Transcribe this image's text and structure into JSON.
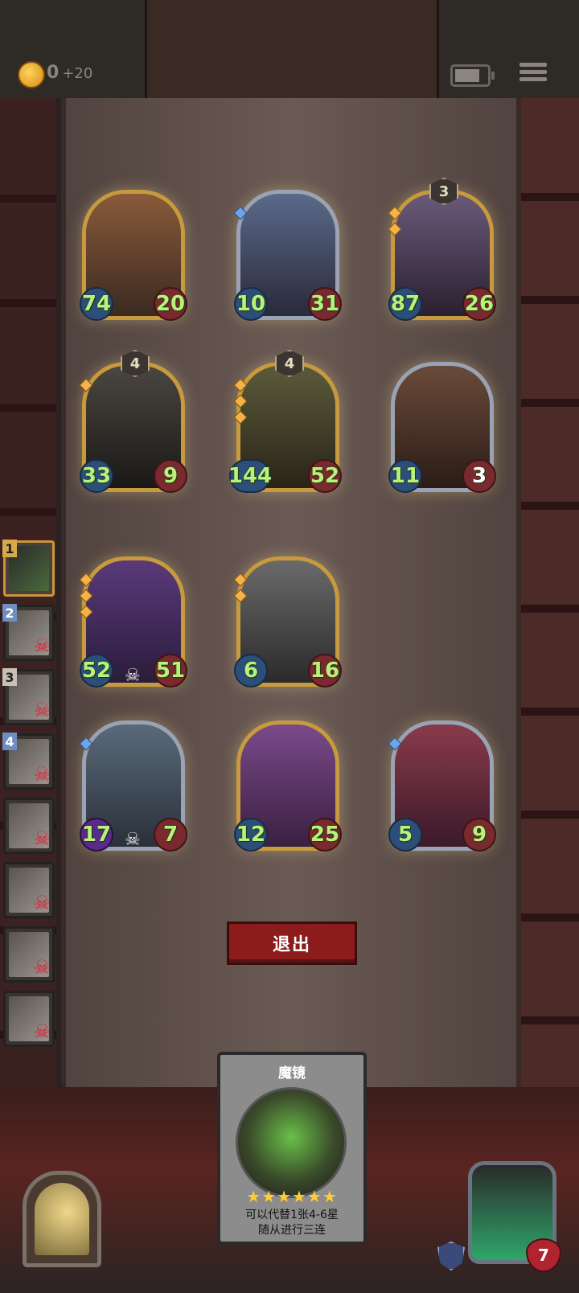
{
  "topbar": {
    "gold": "0",
    "gold_income": "+20"
  },
  "board": {
    "minions": [
      {
        "attack": "74",
        "health": "20",
        "tier": "",
        "frame": "gold",
        "art_color": "#8a5a3a"
      },
      {
        "attack": "10",
        "health": "31",
        "tier": "",
        "frame": "silver",
        "art_color": "#5a6a8a"
      },
      {
        "attack": "87",
        "health": "26",
        "tier": "3",
        "frame": "gold",
        "art_color": "#6a5a7a"
      },
      {
        "attack": "33",
        "health": "9",
        "tier": "4",
        "frame": "gold",
        "art_color": "#4a4640"
      },
      {
        "attack": "144",
        "health": "52",
        "tier": "4",
        "frame": "gold",
        "art_color": "#5a5a3a"
      },
      {
        "attack": "11",
        "health": "3",
        "tier": "",
        "frame": "silver",
        "art_color": "#6a4a3a"
      },
      {
        "attack": "52",
        "health": "51",
        "tier": "",
        "frame": "gold",
        "art_color": "#5a3a7a"
      },
      {
        "attack": "6",
        "health": "16",
        "tier": "",
        "frame": "gold",
        "art_color": "#6a6a6a"
      },
      {
        "attack": "17",
        "health": "7",
        "tier": "",
        "frame": "silver",
        "art_color": "#5a6a7a"
      },
      {
        "attack": "12",
        "health": "25",
        "tier": "",
        "frame": "gold",
        "art_color": "#7a4a8a"
      },
      {
        "attack": "5",
        "health": "9",
        "tier": "",
        "frame": "silver",
        "art_color": "#8a3a4a"
      }
    ]
  },
  "heroes": [
    {
      "rank": "1",
      "status": "alive"
    },
    {
      "rank": "2",
      "status": "dead"
    },
    {
      "rank": "3",
      "status": "dead"
    },
    {
      "rank": "4",
      "status": "dead"
    },
    {
      "rank": "",
      "status": "dead"
    },
    {
      "rank": "",
      "status": "dead"
    },
    {
      "rank": "",
      "status": "dead"
    },
    {
      "rank": "",
      "status": "dead"
    }
  ],
  "exit_button": {
    "label": "退出"
  },
  "spell_card": {
    "title": "魔镜",
    "stars": "★★★★★★",
    "desc_line1": "可以代替1张4-6星",
    "desc_line2": "随从进行三连"
  },
  "player": {
    "health": "7"
  },
  "colors": {
    "accent_gold": "#c79a3d",
    "attack_text": "#b9f27a",
    "exit_button": "#8c1c1c"
  }
}
